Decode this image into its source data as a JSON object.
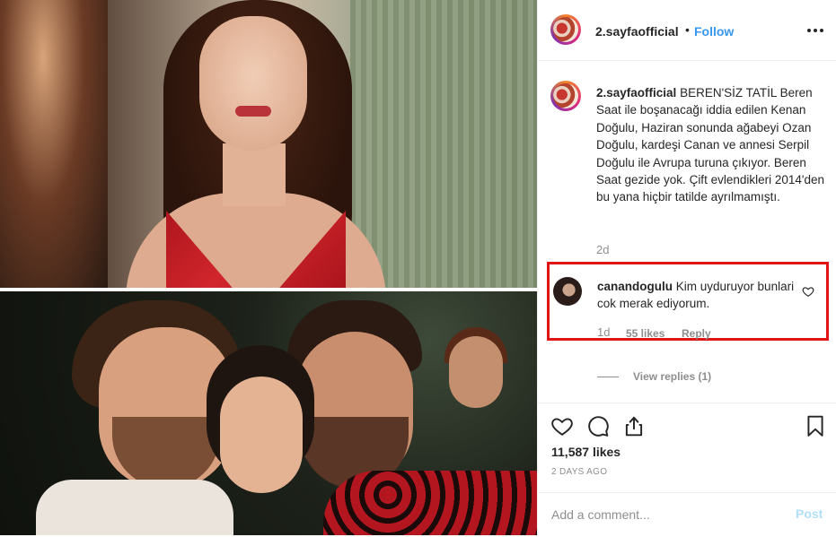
{
  "post": {
    "username": "2.sayfaofficial",
    "follow_label": "Follow",
    "separator": "•",
    "caption": {
      "username": "2.sayfaofficial",
      "text": "BEREN'SİZ TATİL Beren Saat ile boşanacağı iddia edilen Kenan Doğulu, Haziran sonunda ağabeyi Ozan Doğulu, kardeşi Canan ve annesi Serpil Doğulu ile Avrupa turuna çıkıyor. Beren Saat gezide yok. Çift evlendikleri 2014'den bu yana hiçbir tatilde ayrılmamıştı.",
      "time": "2d"
    },
    "highlighted_comment": {
      "username": "canandogulu",
      "text": "Kim uyduruyor bunlari cok merak ediyorum.",
      "time": "1d",
      "likes": "55 likes",
      "reply_label": "Reply",
      "highlight_color": "#e01414"
    },
    "view_replies_label": "View replies (1)",
    "likes_count": "11,587 likes",
    "posted_ago": "2 DAYS AGO",
    "add_comment": {
      "placeholder": "Add a comment...",
      "post_label": "Post"
    },
    "colors": {
      "link": "#3897f0",
      "muted": "#8e8e8e",
      "post_disabled": "#b2dffc"
    }
  }
}
